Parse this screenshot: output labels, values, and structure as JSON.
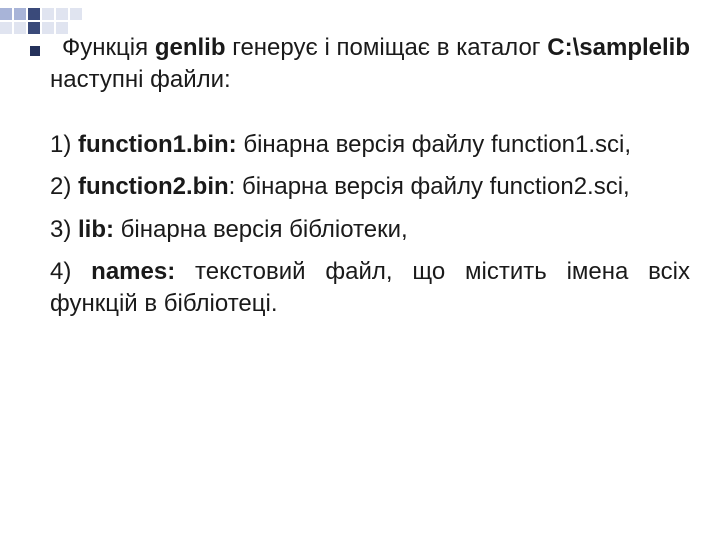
{
  "intro": {
    "lead": " Функція ",
    "genlib": "genlib",
    "mid": " генерує і поміщає в каталог ",
    "path": "C:\\samplelib",
    "tail": " наступні файли:"
  },
  "items": [
    {
      "num": "1) ",
      "name": "function1.bin:",
      "desc": " бінарна версія файлу function1.sci,"
    },
    {
      "num": "2) ",
      "name": "function2.bin",
      "desc": ": бінарна версія файлу function2.sci,"
    },
    {
      "num": "3) ",
      "name": "lib:",
      "desc": " бінарна версія бібліотеки,"
    },
    {
      "num": "4) ",
      "name": "names:",
      "desc": " текстовий файл, що містить імена всіх функцій в бібліотеці."
    }
  ]
}
